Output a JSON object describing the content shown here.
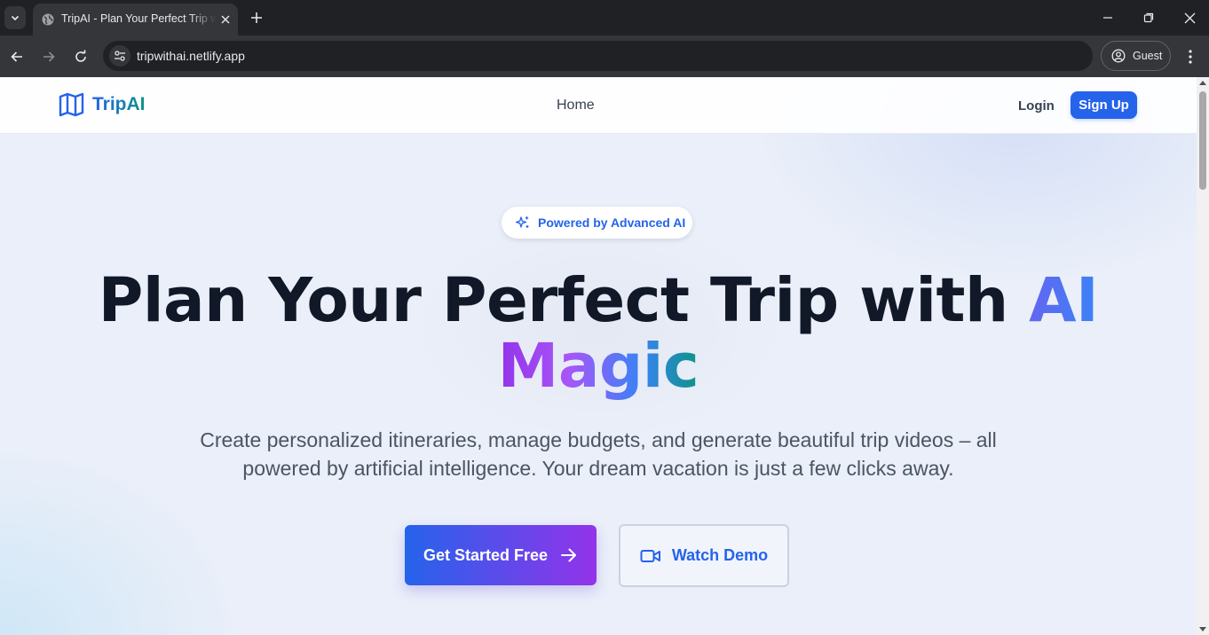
{
  "browser": {
    "tab_title": "TripAI - Plan Your Perfect Trip with AI Magic",
    "url": "tripwithai.netlify.app",
    "profile_label": "Guest"
  },
  "site": {
    "brand": "TripAI",
    "nav": {
      "home": "Home",
      "login": "Login",
      "signup": "Sign Up"
    }
  },
  "hero": {
    "badge": "Powered by Advanced AI",
    "title_main": "Plan Your Perfect Trip with ",
    "title_accent": "AI",
    "title_magic": "Magic",
    "subtitle": "Create personalized itineraries, manage budgets, and generate beautiful trip videos – all powered by artificial intelligence. Your dream vacation is just a few clicks away.",
    "cta_primary": "Get Started Free",
    "cta_secondary": "Watch Demo"
  },
  "icons": {
    "tab_search": "chevron-down-icon",
    "favicon": "globe-icon",
    "close": "close-icon",
    "new_tab": "plus-icon",
    "back": "arrow-left-icon",
    "forward": "arrow-right-icon",
    "reload": "reload-icon",
    "site_info": "tune-icon",
    "profile": "profile-icon",
    "menu": "more-vert-icon",
    "logo": "map-icon",
    "badge": "sparkles-icon",
    "cta_primary": "arrow-right-icon",
    "cta_secondary": "video-camera-icon"
  },
  "colors": {
    "brand_blue": "#2563eb",
    "brand_purple": "#9333ea",
    "brand_teal": "#0d9488",
    "heading": "#111827",
    "body_text": "#4b5563"
  }
}
